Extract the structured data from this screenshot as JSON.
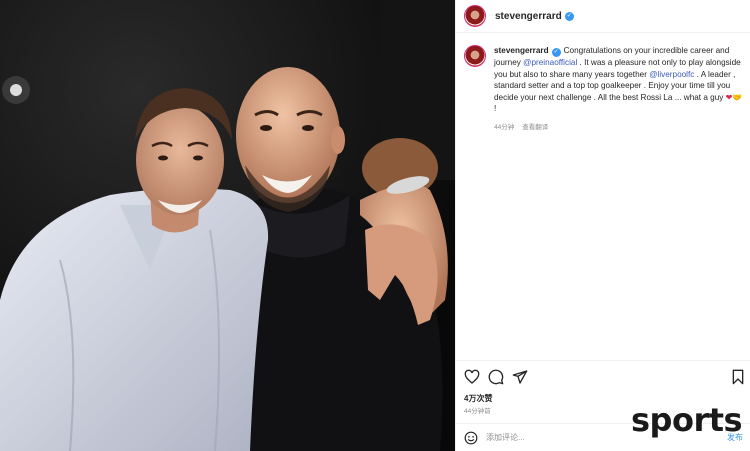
{
  "header": {
    "username": "stevengerrard",
    "verified": true
  },
  "caption": {
    "username": "stevengerrard",
    "text_1": "Congratulations on your incredible career and journey ",
    "mention_1": "@preinaofficial",
    "text_2": " . It was a pleasure not only to play alongside you but also to share many years together ",
    "mention_2": "@liverpoolfc",
    "text_3": " . A leader , standard setter and a top top goalkeeper . Enjoy your time till you decide your next challenge . All the best Rossi La ... what a guy ",
    "emoji_heart": "❤",
    "emoji_hands": "🤝",
    "text_end": " !",
    "time_ago": "44分钟",
    "see_translation": "查看翻译"
  },
  "actions": {
    "icons": [
      "heart-icon",
      "comment-icon",
      "share-icon",
      "bookmark-icon"
    ]
  },
  "stats": {
    "likes": "4万次赞",
    "time": "44分钟前"
  },
  "comment": {
    "placeholder": "添加评论...",
    "post_label": "发布"
  },
  "watermark": {
    "text": "sports"
  },
  "colors": {
    "link": "#3b5bb8",
    "verified": "#3897f0",
    "muted": "#8e8e8e",
    "border": "#efefef"
  }
}
